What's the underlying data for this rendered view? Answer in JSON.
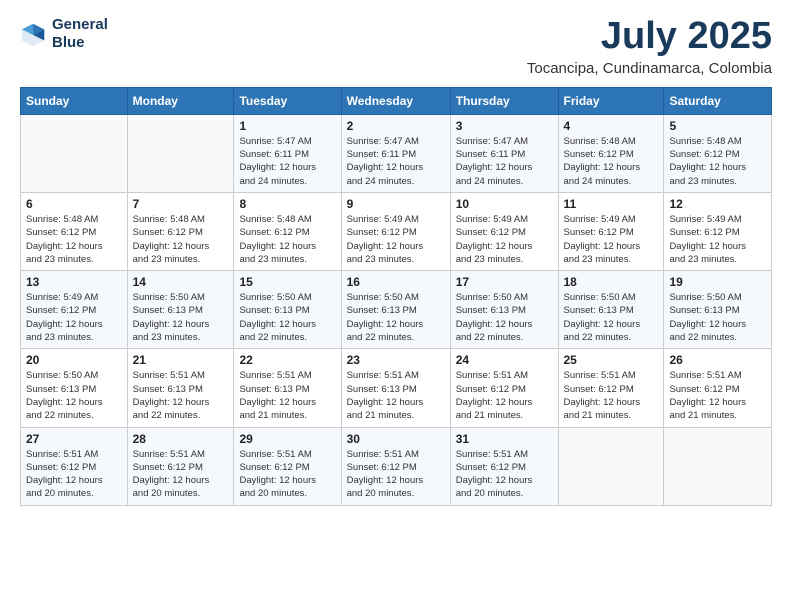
{
  "header": {
    "logo_line1": "General",
    "logo_line2": "Blue",
    "title": "July 2025",
    "subtitle": "Tocancipa, Cundinamarca, Colombia"
  },
  "weekdays": [
    "Sunday",
    "Monday",
    "Tuesday",
    "Wednesday",
    "Thursday",
    "Friday",
    "Saturday"
  ],
  "weeks": [
    [
      {
        "day": "",
        "info": ""
      },
      {
        "day": "",
        "info": ""
      },
      {
        "day": "1",
        "info": "Sunrise: 5:47 AM\nSunset: 6:11 PM\nDaylight: 12 hours\nand 24 minutes."
      },
      {
        "day": "2",
        "info": "Sunrise: 5:47 AM\nSunset: 6:11 PM\nDaylight: 12 hours\nand 24 minutes."
      },
      {
        "day": "3",
        "info": "Sunrise: 5:47 AM\nSunset: 6:11 PM\nDaylight: 12 hours\nand 24 minutes."
      },
      {
        "day": "4",
        "info": "Sunrise: 5:48 AM\nSunset: 6:12 PM\nDaylight: 12 hours\nand 24 minutes."
      },
      {
        "day": "5",
        "info": "Sunrise: 5:48 AM\nSunset: 6:12 PM\nDaylight: 12 hours\nand 23 minutes."
      }
    ],
    [
      {
        "day": "6",
        "info": "Sunrise: 5:48 AM\nSunset: 6:12 PM\nDaylight: 12 hours\nand 23 minutes."
      },
      {
        "day": "7",
        "info": "Sunrise: 5:48 AM\nSunset: 6:12 PM\nDaylight: 12 hours\nand 23 minutes."
      },
      {
        "day": "8",
        "info": "Sunrise: 5:48 AM\nSunset: 6:12 PM\nDaylight: 12 hours\nand 23 minutes."
      },
      {
        "day": "9",
        "info": "Sunrise: 5:49 AM\nSunset: 6:12 PM\nDaylight: 12 hours\nand 23 minutes."
      },
      {
        "day": "10",
        "info": "Sunrise: 5:49 AM\nSunset: 6:12 PM\nDaylight: 12 hours\nand 23 minutes."
      },
      {
        "day": "11",
        "info": "Sunrise: 5:49 AM\nSunset: 6:12 PM\nDaylight: 12 hours\nand 23 minutes."
      },
      {
        "day": "12",
        "info": "Sunrise: 5:49 AM\nSunset: 6:12 PM\nDaylight: 12 hours\nand 23 minutes."
      }
    ],
    [
      {
        "day": "13",
        "info": "Sunrise: 5:49 AM\nSunset: 6:12 PM\nDaylight: 12 hours\nand 23 minutes."
      },
      {
        "day": "14",
        "info": "Sunrise: 5:50 AM\nSunset: 6:13 PM\nDaylight: 12 hours\nand 23 minutes."
      },
      {
        "day": "15",
        "info": "Sunrise: 5:50 AM\nSunset: 6:13 PM\nDaylight: 12 hours\nand 22 minutes."
      },
      {
        "day": "16",
        "info": "Sunrise: 5:50 AM\nSunset: 6:13 PM\nDaylight: 12 hours\nand 22 minutes."
      },
      {
        "day": "17",
        "info": "Sunrise: 5:50 AM\nSunset: 6:13 PM\nDaylight: 12 hours\nand 22 minutes."
      },
      {
        "day": "18",
        "info": "Sunrise: 5:50 AM\nSunset: 6:13 PM\nDaylight: 12 hours\nand 22 minutes."
      },
      {
        "day": "19",
        "info": "Sunrise: 5:50 AM\nSunset: 6:13 PM\nDaylight: 12 hours\nand 22 minutes."
      }
    ],
    [
      {
        "day": "20",
        "info": "Sunrise: 5:50 AM\nSunset: 6:13 PM\nDaylight: 12 hours\nand 22 minutes."
      },
      {
        "day": "21",
        "info": "Sunrise: 5:51 AM\nSunset: 6:13 PM\nDaylight: 12 hours\nand 22 minutes."
      },
      {
        "day": "22",
        "info": "Sunrise: 5:51 AM\nSunset: 6:13 PM\nDaylight: 12 hours\nand 21 minutes."
      },
      {
        "day": "23",
        "info": "Sunrise: 5:51 AM\nSunset: 6:13 PM\nDaylight: 12 hours\nand 21 minutes."
      },
      {
        "day": "24",
        "info": "Sunrise: 5:51 AM\nSunset: 6:12 PM\nDaylight: 12 hours\nand 21 minutes."
      },
      {
        "day": "25",
        "info": "Sunrise: 5:51 AM\nSunset: 6:12 PM\nDaylight: 12 hours\nand 21 minutes."
      },
      {
        "day": "26",
        "info": "Sunrise: 5:51 AM\nSunset: 6:12 PM\nDaylight: 12 hours\nand 21 minutes."
      }
    ],
    [
      {
        "day": "27",
        "info": "Sunrise: 5:51 AM\nSunset: 6:12 PM\nDaylight: 12 hours\nand 20 minutes."
      },
      {
        "day": "28",
        "info": "Sunrise: 5:51 AM\nSunset: 6:12 PM\nDaylight: 12 hours\nand 20 minutes."
      },
      {
        "day": "29",
        "info": "Sunrise: 5:51 AM\nSunset: 6:12 PM\nDaylight: 12 hours\nand 20 minutes."
      },
      {
        "day": "30",
        "info": "Sunrise: 5:51 AM\nSunset: 6:12 PM\nDaylight: 12 hours\nand 20 minutes."
      },
      {
        "day": "31",
        "info": "Sunrise: 5:51 AM\nSunset: 6:12 PM\nDaylight: 12 hours\nand 20 minutes."
      },
      {
        "day": "",
        "info": ""
      },
      {
        "day": "",
        "info": ""
      }
    ]
  ]
}
